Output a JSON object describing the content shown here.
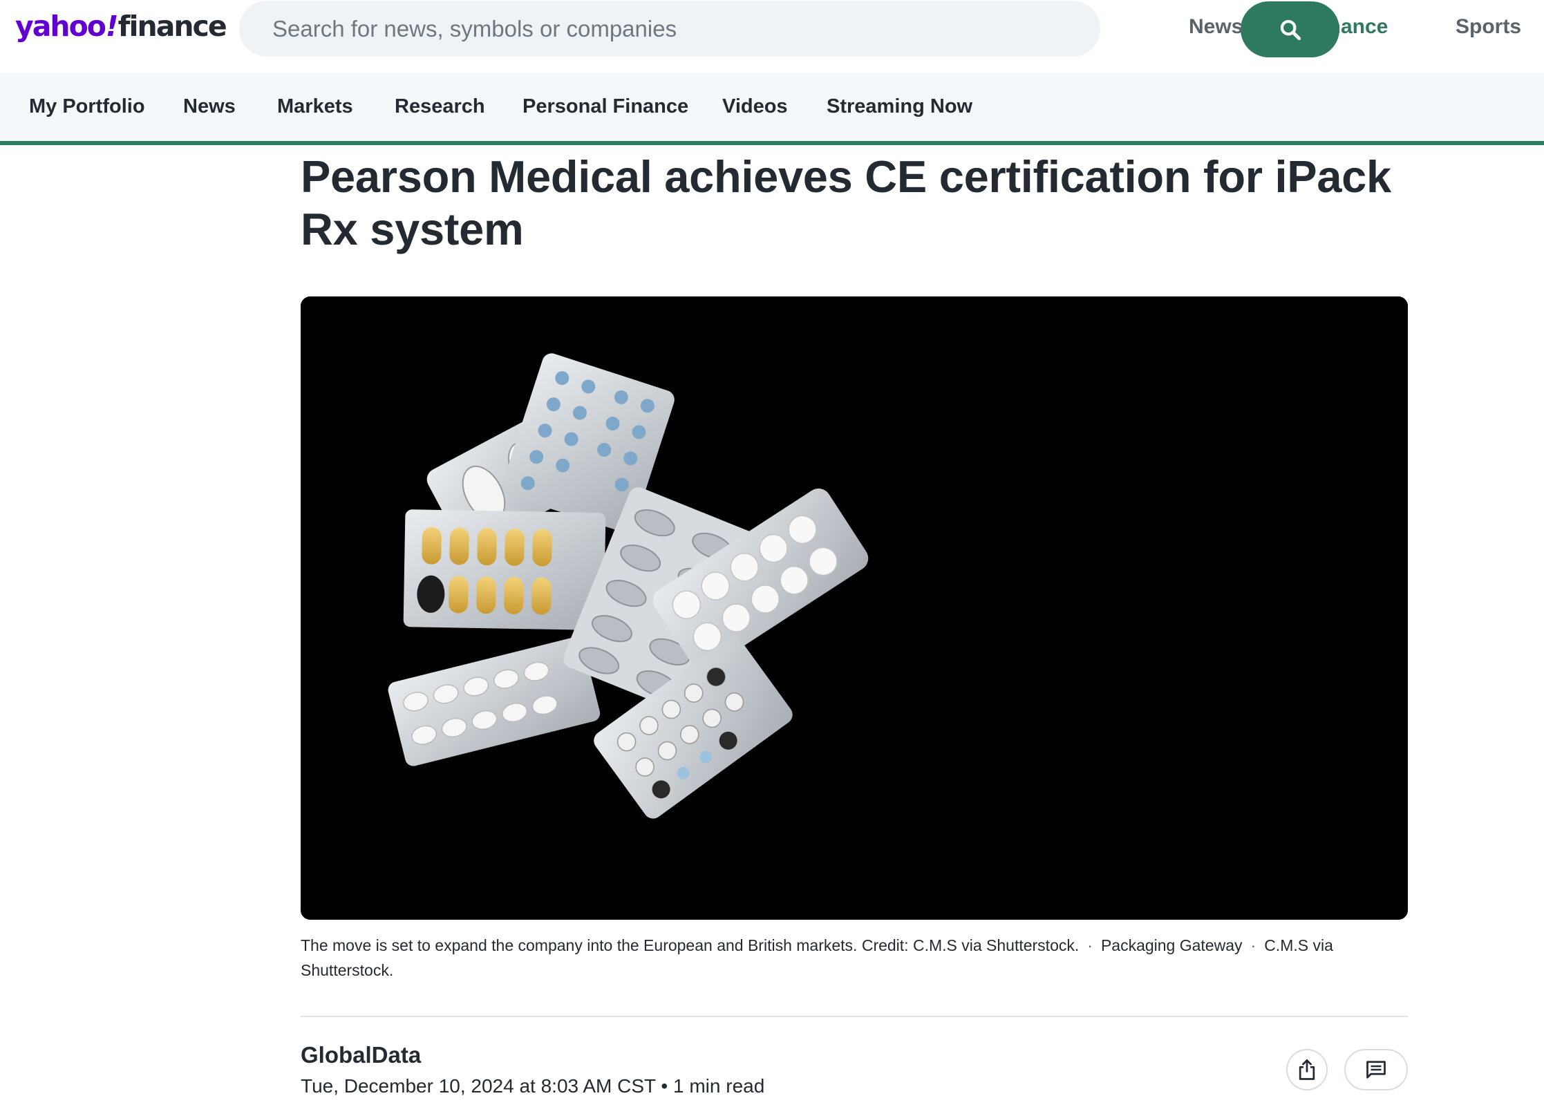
{
  "header": {
    "logo_yahoo": "yahoo",
    "logo_slash": "!",
    "logo_finance": "finance",
    "search": {
      "placeholder": "Search for news, symbols or companies",
      "button_icon": "search-icon"
    },
    "nav": [
      {
        "label": "News",
        "active": false
      },
      {
        "label": "Finance",
        "active": true
      },
      {
        "label": "Sports",
        "active": false
      }
    ]
  },
  "subnav": {
    "items": [
      "My Portfolio",
      "News",
      "Markets",
      "Research",
      "Personal Finance",
      "Videos",
      "Streaming Now"
    ]
  },
  "article": {
    "headline": "Pearson Medical achieves CE certification for iPack Rx system",
    "image_alt": "Blister packs of assorted pills on a black background",
    "caption": {
      "text": "The move is set to expand the company into the European and British markets. Credit: C.M.S via Shutterstock.",
      "source": "Packaging Gateway",
      "credit": "C.M.S via Shutterstock."
    },
    "author": "GlobalData",
    "date": "Tue, December 10, 2024 at 8:03 AM CST",
    "read_time": "1 min read",
    "separator": "•"
  },
  "colors": {
    "brand_purple": "#6001d2",
    "finance_green": "#2d7a5f"
  },
  "icons": [
    "search-icon",
    "share-icon",
    "comment-icon"
  ]
}
